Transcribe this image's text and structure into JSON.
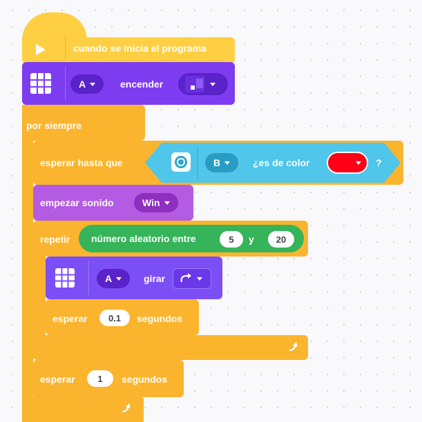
{
  "blocks": {
    "start": {
      "label": "cuando se inicia el programa"
    },
    "light": {
      "port": "A",
      "action": "encender"
    },
    "forever": {
      "label": "por siempre"
    },
    "wait_until": {
      "label": "esperar hasta que",
      "port": "B",
      "condition": "¿es de color",
      "color": "#ff0017",
      "suffix": "?"
    },
    "sound": {
      "label": "empezar sonido",
      "sound": "Win"
    },
    "repeat": {
      "label": "repetir",
      "random_label": "número aleatorio entre",
      "min": "5",
      "and": "y",
      "max": "20"
    },
    "motor": {
      "port": "A",
      "action": "girar"
    },
    "wait_short": {
      "label": "esperar",
      "value": "0.1",
      "unit": "segundos"
    },
    "wait_long": {
      "label": "esperar",
      "value": "1",
      "unit": "segundos"
    }
  },
  "colors": {
    "event": "#ffd24f",
    "event_dark": "#ebb600",
    "light": "#7e3df1",
    "control": "#fbb42e",
    "sensor": "#4fc6ea",
    "sound": "#b45ae3",
    "operator": "#35b45a",
    "motor": "#7c4ef5",
    "red": "#ff0017"
  }
}
